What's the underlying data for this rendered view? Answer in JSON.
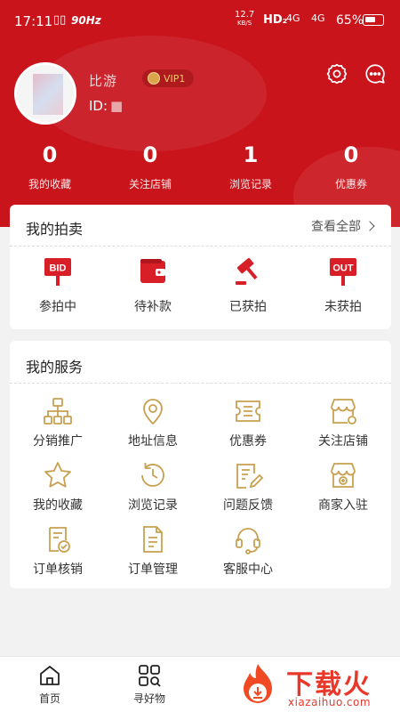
{
  "status_bar": {
    "time": "17:11",
    "vibrate": "▯▯",
    "refresh_rate": "90Hz",
    "net_speed_value": "12.7",
    "net_speed_unit": "KB/S",
    "hd": "HD₂",
    "signal1": "4G",
    "signal2": "4G",
    "battery": "65%",
    "battery_level": 0.65
  },
  "profile": {
    "username": "比游",
    "vip_label": "VIP1",
    "id_label": "ID:",
    "id_value": "■"
  },
  "stats": [
    {
      "value": "0",
      "label": "我的收藏"
    },
    {
      "value": "0",
      "label": "关注店铺"
    },
    {
      "value": "1",
      "label": "浏览记录"
    },
    {
      "value": "0",
      "label": "优惠券"
    }
  ],
  "auction": {
    "title": "我的拍卖",
    "view_all": "查看全部",
    "items": [
      {
        "label": "参拍中",
        "icon": "bid-sign-icon",
        "sign": "BID"
      },
      {
        "label": "待补款",
        "icon": "wallet-icon"
      },
      {
        "label": "已获拍",
        "icon": "gavel-icon"
      },
      {
        "label": "未获拍",
        "icon": "out-sign-icon",
        "sign": "OUT"
      }
    ]
  },
  "services": {
    "title": "我的服务",
    "items": [
      {
        "label": "分销推广",
        "icon": "org-chart-icon"
      },
      {
        "label": "地址信息",
        "icon": "location-pin-icon"
      },
      {
        "label": "优惠券",
        "icon": "coupon-icon"
      },
      {
        "label": "关注店铺",
        "icon": "store-follow-icon"
      },
      {
        "label": "我的收藏",
        "icon": "star-icon"
      },
      {
        "label": "浏览记录",
        "icon": "history-clock-icon"
      },
      {
        "label": "问题反馈",
        "icon": "feedback-edit-icon"
      },
      {
        "label": "商家入驻",
        "icon": "store-add-icon"
      },
      {
        "label": "订单核销",
        "icon": "order-verify-icon"
      },
      {
        "label": "订单管理",
        "icon": "order-list-icon"
      },
      {
        "label": "客服中心",
        "icon": "headset-icon"
      }
    ]
  },
  "tabbar": [
    {
      "label": "首页",
      "icon": "home-icon"
    },
    {
      "label": "寻好物",
      "icon": "grid-search-icon"
    }
  ],
  "watermark": {
    "text": "下载火",
    "url": "xiazaihuo.com"
  },
  "colors": {
    "brand_red": "#c9141c",
    "gold": "#c8a050",
    "icon_red": "#d81e26"
  }
}
